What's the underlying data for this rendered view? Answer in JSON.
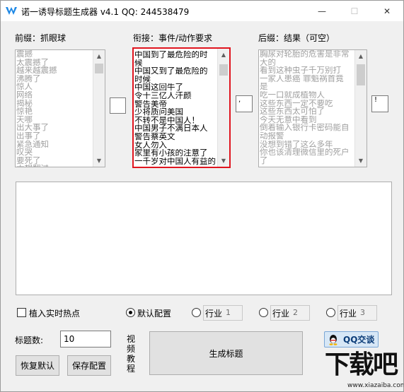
{
  "window": {
    "title": "诺一诱导标题生成器 v4.1    QQ:   244538479",
    "minimize": "—",
    "maximize": "☐",
    "close": "✕"
  },
  "prefix": {
    "label": "前缀：抓眼球",
    "items": [
      "震撼",
      "太震撼了",
      "越来越震撼",
      "沸腾了",
      "惊人",
      "网络",
      "揭秘",
      "惊艳",
      "天哪",
      "出大事了",
      "出事了",
      "紧急通知",
      "叹哭",
      "要死了",
      "太想翻过"
    ],
    "side_value": ""
  },
  "link": {
    "label": "衔接：事件/动作要求",
    "items": [
      "中国到了最危险的时",
      "候",
      "中国又到了最危险的",
      "时候",
      "中国这回牛了",
      "令十三亿人汗颜",
      "警告美帝",
      "少将质问美国",
      "不转不是中国人！",
      "中国男子不满日本人",
      "警告蔡英文",
      "女人勿入",
      "家里有小孩的注意了",
      "一千岁对中国人有益的"
    ],
    "side_value": ","
  },
  "suffix": {
    "label": "后缀：结果（可空）",
    "items": [
      "胸尿对轮胎的危害是非常",
      "大的",
      "看到这种虫子千万别打",
      "一家人患癌 罪魁祸首竟",
      "是",
      "吃一口就成植物人",
      "这些东西一定不要吃",
      "这些东西太可怕了",
      "今天无意中看到",
      "倒着输入银行卡密码能自",
      "动报警",
      "没想到错了这么多年",
      "你也该清理微信里的死户",
      "了"
    ],
    "side_value": "!"
  },
  "options": {
    "hot_topic_label": "植入实时热点",
    "default_label": "默认配置",
    "industry_label": "行业",
    "industry_values": [
      "1",
      "2",
      "3"
    ]
  },
  "controls": {
    "count_label": "标题数:",
    "count_value": "10",
    "restore_label": "恢复默认",
    "save_label": "保存配置",
    "video_label": "视频教程",
    "generate_label": "生成标题",
    "qq_label": "QQ交谈"
  },
  "watermark": {
    "brand": "下载吧",
    "url": "www.xiazaiba.com"
  },
  "colors": {
    "highlight_border": "#e0141e",
    "app_icon": "#1e88e5"
  }
}
